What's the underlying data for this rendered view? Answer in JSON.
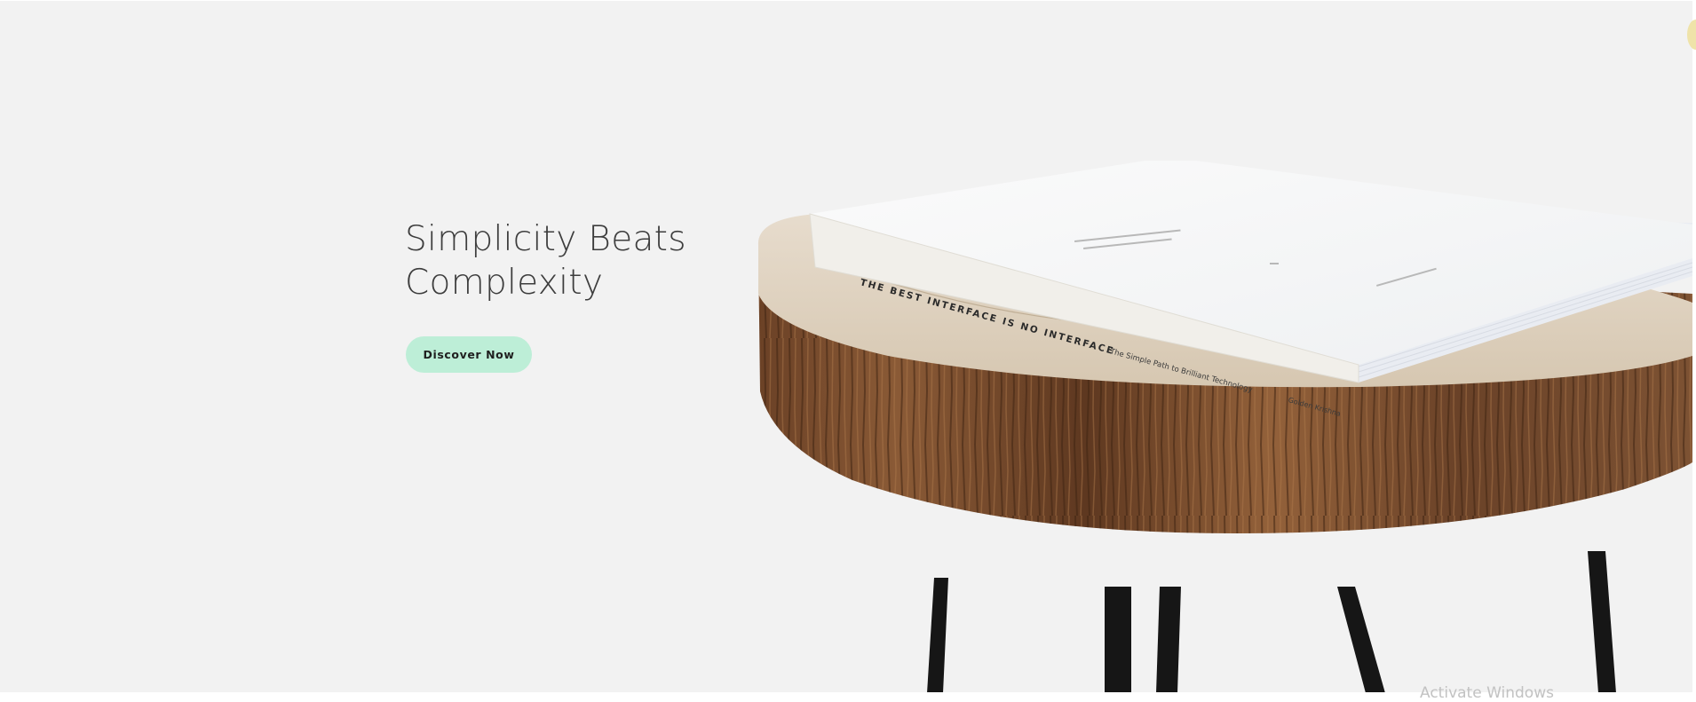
{
  "hero": {
    "headline_line1": "Simplicity Beats",
    "headline_line2": "Complexity",
    "cta_label": "Discover Now"
  },
  "book": {
    "spine_title": "THE BEST INTERFACE IS NO INTERFACE",
    "spine_subtitle": "The Simple Path to Brilliant Technology",
    "spine_author": "Golden Krishna"
  },
  "system": {
    "watermark": "Activate Windows"
  },
  "colors": {
    "background": "#f2f2f2",
    "cta_background": "#bdeed7",
    "headline_text": "#3d3d3d"
  }
}
